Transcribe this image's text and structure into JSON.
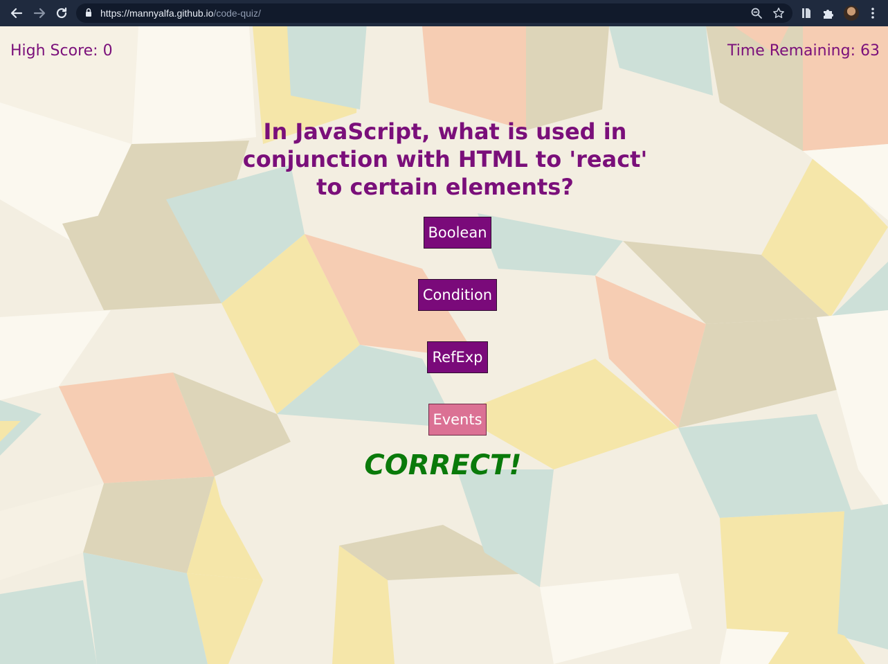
{
  "browser": {
    "url_host": "https://mannyalfa.github.io",
    "url_path": "/code-quiz/",
    "icons": [
      "back-arrow-icon",
      "forward-arrow-icon",
      "reload-icon",
      "lock-icon",
      "zoom-icon",
      "star-icon",
      "extension-icon",
      "puzzle-icon",
      "avatar",
      "more-vert-icon"
    ]
  },
  "quiz": {
    "high_score": "High Score: 0",
    "time_remaining": "Time Remaining: 63",
    "question": "In JavaScript, what is used in conjunction with HTML to 'react' to certain elements?",
    "answers": [
      {
        "label": "Boolean"
      },
      {
        "label": "Condition"
      },
      {
        "label": "RefExp"
      },
      {
        "label": "Events",
        "selected": true
      }
    ],
    "feedback": "CORRECT!"
  },
  "colors": {
    "accent": "#7a0a7a",
    "selected_answer": "#db7194",
    "correct": "#0a7a0a",
    "tile_colors": [
      "#f4eddc",
      "#ddd5b9",
      "#cde0d8",
      "#f5e6a8",
      "#f6cdb3",
      "#fbf7ee"
    ]
  }
}
